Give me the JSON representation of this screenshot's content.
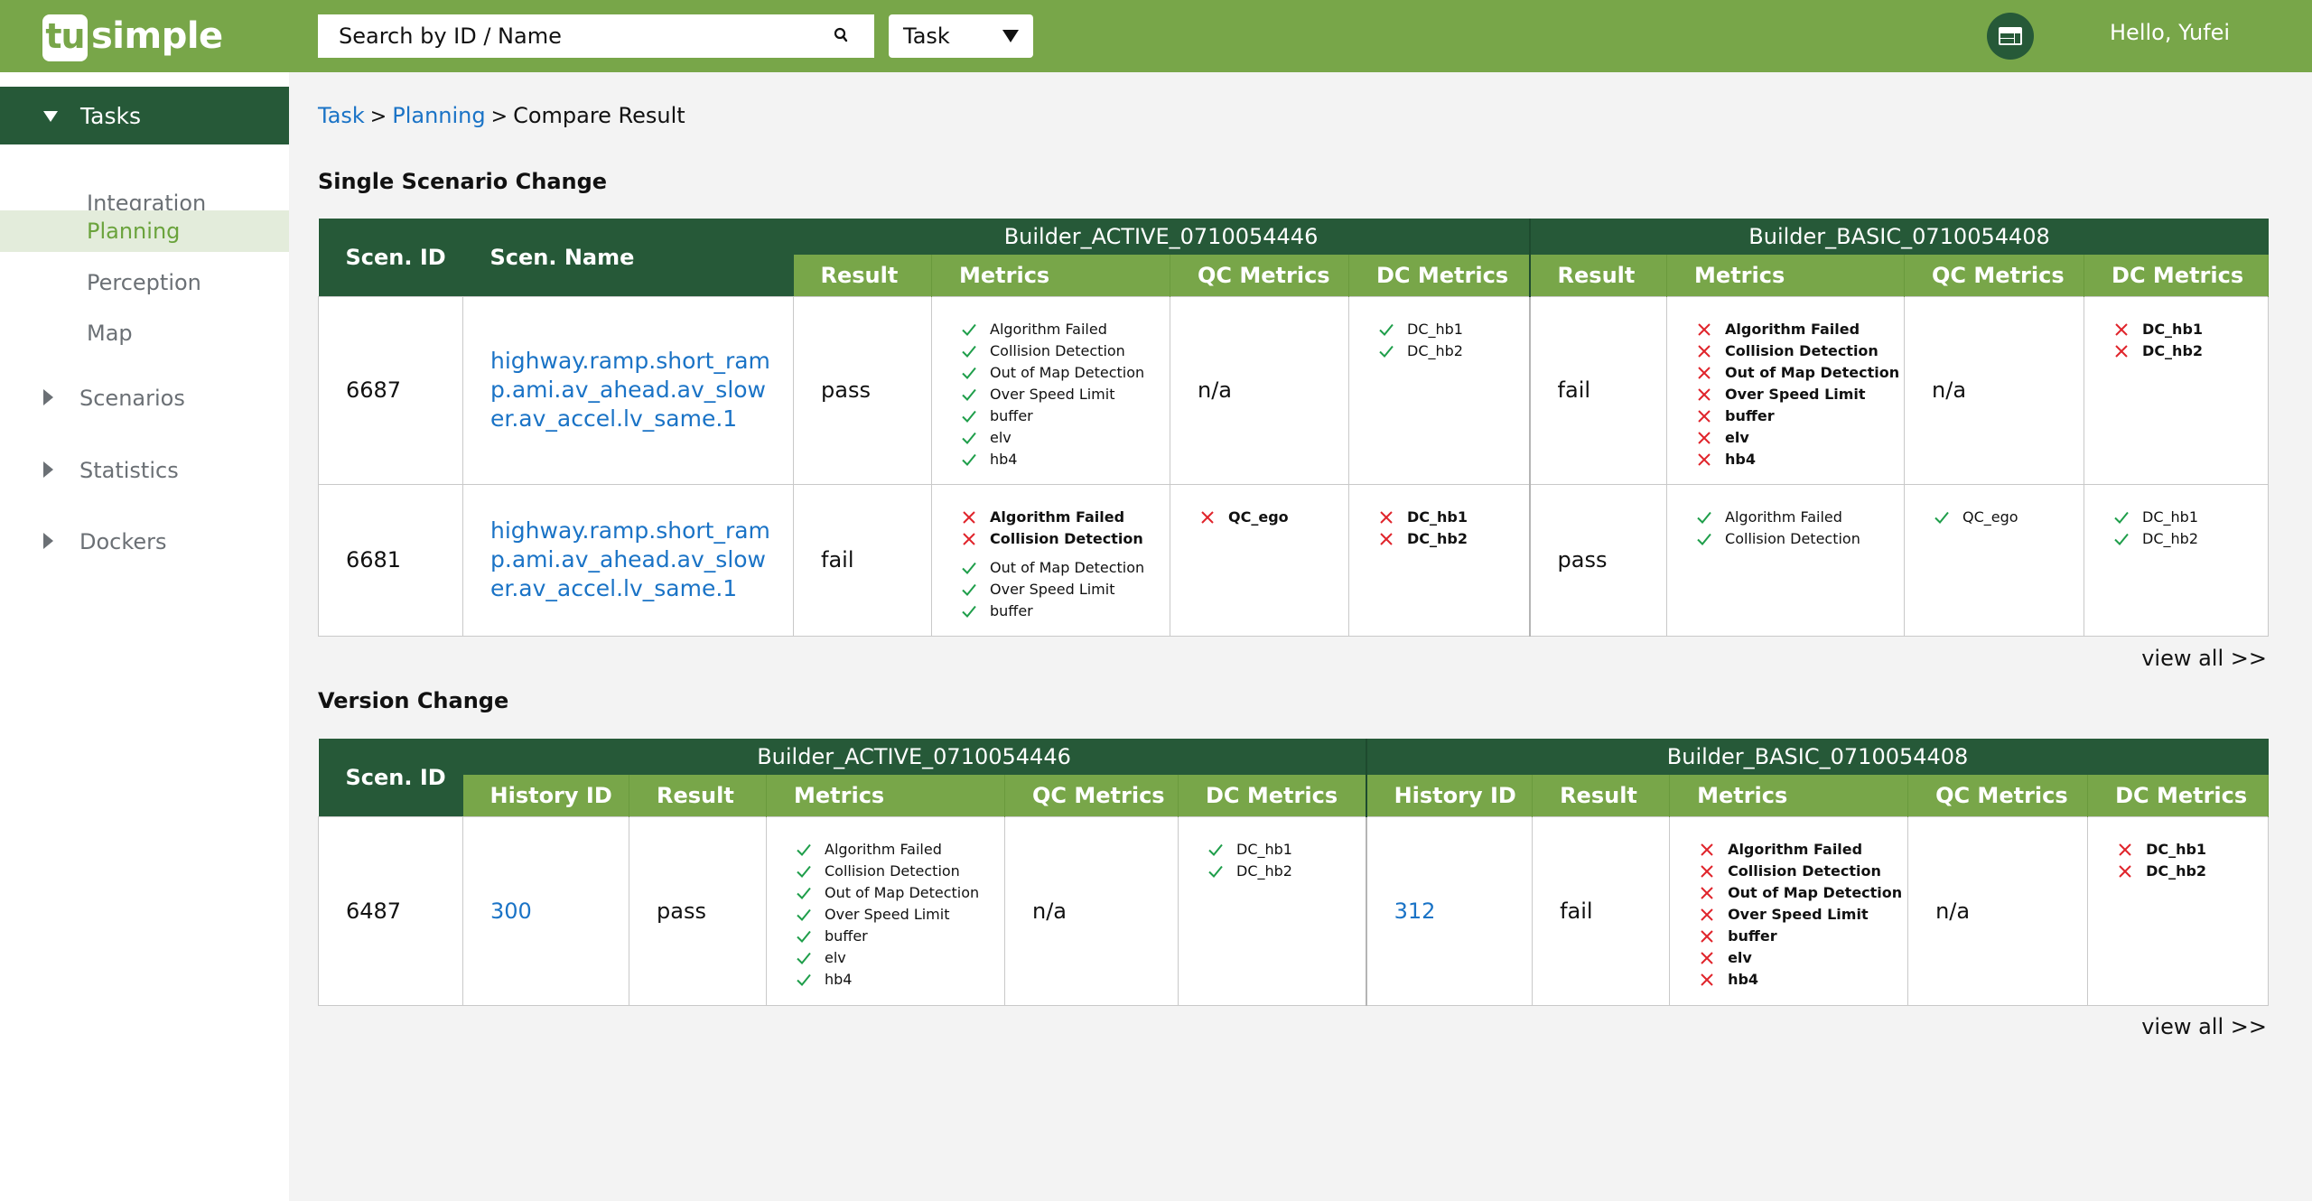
{
  "header": {
    "logo_box_text": "tu",
    "logo_word": "simple",
    "search_placeholder": "Search by ID / Name",
    "select_value": "Task",
    "greeting": "Hello, Yufei",
    "brand_color": "#78a649",
    "dark_color": "#265938"
  },
  "sidebar": {
    "expanded_group": "Tasks",
    "sub_items": [
      "Integration",
      "Planning",
      "Perception",
      "Map"
    ],
    "active_sub_item": "Planning",
    "collapsed_groups": [
      "Scenarios",
      "Statistics",
      "Dockers"
    ]
  },
  "breadcrumb": {
    "items": [
      "Task",
      "Planning",
      "Compare Result"
    ],
    "separator": ">"
  },
  "single_scenario": {
    "title": "Single Scenario Change",
    "headers": {
      "scen_id": "Scen. ID",
      "scen_name": "Scen. Name",
      "result": "Result",
      "metrics": "Metrics",
      "qc_metrics": "QC Metrics",
      "dc_metrics": "DC Metrics"
    },
    "builders": [
      "Builder_ACTIVE_0710054446",
      "Builder_BASIC_0710054408"
    ],
    "rows": [
      {
        "scen_id": "6687",
        "scen_name": "highway.ramp.short_ramp.ami.av_ahead.av_slower.av_accel.lv_same.1",
        "builds": [
          {
            "result": "pass",
            "metrics": [
              {
                "name": "Algorithm Failed",
                "status": "pass"
              },
              {
                "name": "Collision Detection",
                "status": "pass"
              },
              {
                "name": "Out of Map Detection",
                "status": "pass"
              },
              {
                "name": "Over Speed Limit",
                "status": "pass"
              },
              {
                "name": "buffer",
                "status": "pass"
              },
              {
                "name": "elv",
                "status": "pass"
              },
              {
                "name": "hb4",
                "status": "pass"
              }
            ],
            "qc_metrics_text": "n/a",
            "qc_metrics": [],
            "dc_metrics": [
              {
                "name": "DC_hb1",
                "status": "pass"
              },
              {
                "name": "DC_hb2",
                "status": "pass"
              }
            ]
          },
          {
            "result": "fail",
            "metrics": [
              {
                "name": "Algorithm Failed",
                "status": "fail"
              },
              {
                "name": "Collision Detection",
                "status": "fail"
              },
              {
                "name": "Out of Map Detection",
                "status": "fail"
              },
              {
                "name": "Over Speed Limit",
                "status": "fail"
              },
              {
                "name": "buffer",
                "status": "fail"
              },
              {
                "name": "elv",
                "status": "fail"
              },
              {
                "name": "hb4",
                "status": "fail"
              }
            ],
            "qc_metrics_text": "n/a",
            "qc_metrics": [],
            "dc_metrics": [
              {
                "name": "DC_hb1",
                "status": "fail"
              },
              {
                "name": "DC_hb2",
                "status": "fail"
              }
            ]
          }
        ]
      },
      {
        "scen_id": "6681",
        "scen_name": "highway.ramp.short_ramp.ami.av_ahead.av_slower.av_accel.lv_same.1",
        "builds": [
          {
            "result": "fail",
            "metrics": [
              {
                "name": "Algorithm Failed",
                "status": "fail"
              },
              {
                "name": "Collision Detection",
                "status": "fail"
              },
              {
                "name": "Out of Map Detection",
                "status": "pass"
              },
              {
                "name": "Over Speed Limit",
                "status": "pass"
              },
              {
                "name": "buffer",
                "status": "pass"
              }
            ],
            "qc_metrics_text": "",
            "qc_metrics": [
              {
                "name": "QC_ego",
                "status": "fail"
              }
            ],
            "dc_metrics": [
              {
                "name": "DC_hb1",
                "status": "fail"
              },
              {
                "name": "DC_hb2",
                "status": "fail"
              }
            ]
          },
          {
            "result": "pass",
            "metrics": [
              {
                "name": "Algorithm Failed",
                "status": "pass"
              },
              {
                "name": "Collision Detection",
                "status": "pass"
              }
            ],
            "qc_metrics_text": "",
            "qc_metrics": [
              {
                "name": "QC_ego",
                "status": "pass"
              }
            ],
            "dc_metrics": [
              {
                "name": "DC_hb1",
                "status": "pass"
              },
              {
                "name": "DC_hb2",
                "status": "pass"
              }
            ]
          }
        ]
      }
    ],
    "view_all": "view all >>"
  },
  "version_change": {
    "title": "Version Change",
    "headers": {
      "scen_id": "Scen. ID",
      "history_id": "History ID",
      "result": "Result",
      "metrics": "Metrics",
      "qc_metrics": "QC Metrics",
      "dc_metrics": "DC Metrics"
    },
    "builders": [
      "Builder_ACTIVE_0710054446",
      "Builder_BASIC_0710054408"
    ],
    "rows": [
      {
        "scen_id": "6487",
        "builds": [
          {
            "history_id": "300",
            "result": "pass",
            "metrics": [
              {
                "name": "Algorithm Failed",
                "status": "pass"
              },
              {
                "name": "Collision Detection",
                "status": "pass"
              },
              {
                "name": "Out of Map Detection",
                "status": "pass"
              },
              {
                "name": "Over Speed Limit",
                "status": "pass"
              },
              {
                "name": "buffer",
                "status": "pass"
              },
              {
                "name": "elv",
                "status": "pass"
              },
              {
                "name": "hb4",
                "status": "pass"
              }
            ],
            "qc_metrics_text": "n/a",
            "qc_metrics": [],
            "dc_metrics": [
              {
                "name": "DC_hb1",
                "status": "pass"
              },
              {
                "name": "DC_hb2",
                "status": "pass"
              }
            ]
          },
          {
            "history_id": "312",
            "result": "fail",
            "metrics": [
              {
                "name": "Algorithm Failed",
                "status": "fail"
              },
              {
                "name": "Collision Detection",
                "status": "fail"
              },
              {
                "name": "Out of Map Detection",
                "status": "fail"
              },
              {
                "name": "Over Speed Limit",
                "status": "fail"
              },
              {
                "name": "buffer",
                "status": "fail"
              },
              {
                "name": "elv",
                "status": "fail"
              },
              {
                "name": "hb4",
                "status": "fail"
              }
            ],
            "qc_metrics_text": "n/a",
            "qc_metrics": [],
            "dc_metrics": [
              {
                "name": "DC_hb1",
                "status": "fail"
              },
              {
                "name": "DC_hb2",
                "status": "fail"
              }
            ]
          }
        ]
      }
    ],
    "view_all": "view all >>"
  },
  "status_colors": {
    "pass": "#1e9e4a",
    "fail": "#e0242b",
    "link": "#1a73c6"
  }
}
